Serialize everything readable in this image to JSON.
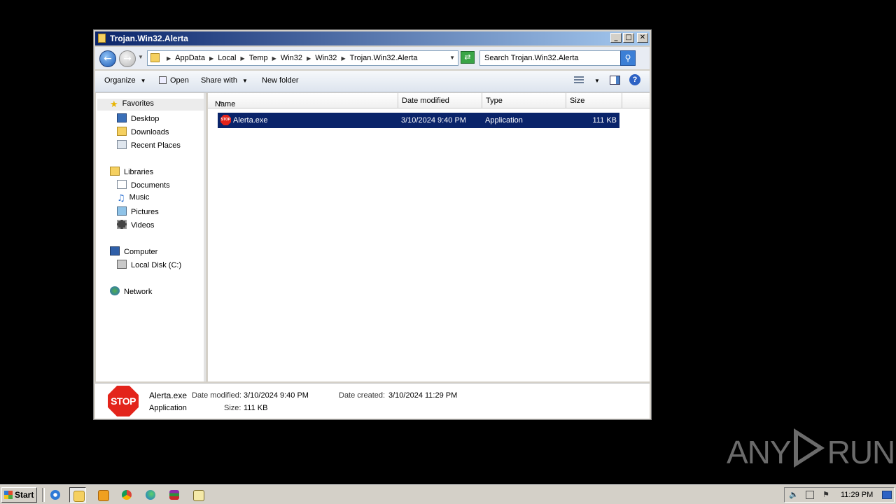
{
  "window": {
    "title": "Trojan.Win32.Alerta",
    "buttons": {
      "minimize": "_",
      "maximize": "□",
      "close": "✕"
    }
  },
  "address": {
    "breadcrumbs": [
      "AppData",
      "Local",
      "Temp",
      "Win32",
      "Win32",
      "Trojan.Win32.Alerta"
    ]
  },
  "search": {
    "placeholder": "Search Trojan.Win32.Alerta"
  },
  "toolbar": {
    "organize": "Organize",
    "open": "Open",
    "share_with": "Share with",
    "new_folder": "New folder"
  },
  "nav": {
    "favorites": "Favorites",
    "desktop": "Desktop",
    "downloads": "Downloads",
    "recent_places": "Recent Places",
    "libraries": "Libraries",
    "documents": "Documents",
    "music": "Music",
    "pictures": "Pictures",
    "videos": "Videos",
    "computer": "Computer",
    "local_disk": "Local Disk (C:)",
    "network": "Network"
  },
  "columns": {
    "name": "Name",
    "date_modified": "Date modified",
    "type": "Type",
    "size": "Size"
  },
  "files": [
    {
      "name": "Alerta.exe",
      "date_modified": "3/10/2024 9:40 PM",
      "type": "Application",
      "size": "111 KB",
      "icon": "stop-sign-icon",
      "selected": true
    }
  ],
  "details": {
    "icon_text": "STOP",
    "name": "Alerta.exe",
    "type": "Application",
    "date_modified_label": "Date modified:",
    "date_modified": "3/10/2024 9:40 PM",
    "size_label": "Size:",
    "size": "111 KB",
    "date_created_label": "Date created:",
    "date_created": "3/10/2024 11:29 PM"
  },
  "watermark": {
    "left": "ANY",
    "right": "RUN"
  },
  "taskbar": {
    "start": "Start",
    "apps": [
      "ie-icon",
      "explorer-icon",
      "media-player-icon",
      "chrome-icon",
      "edge-icon",
      "winrar-icon",
      "notepad-icon"
    ],
    "clock": "11:29 PM"
  }
}
